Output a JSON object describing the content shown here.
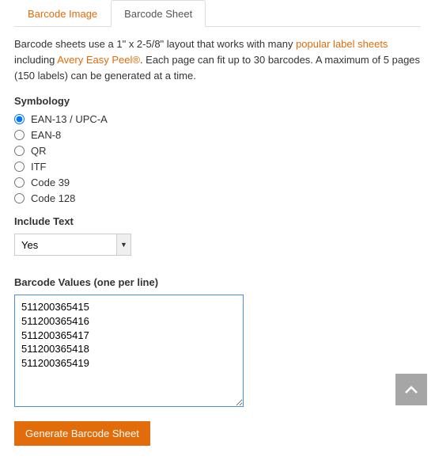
{
  "tabs": [
    {
      "label": "Barcode Image",
      "active": false
    },
    {
      "label": "Barcode Sheet",
      "active": true
    }
  ],
  "intro": {
    "t1": "Barcode sheets use a 1\" x 2-5/8\" layout that works with many ",
    "link1": "popular label sheets",
    "t2": " including ",
    "link2": "Avery Easy Peel®",
    "t3": ". Each page can fit up to 30 barcodes. A maximum of 5 pages (150 labels) can be generated at a time."
  },
  "symbology": {
    "title": "Symbology",
    "options": [
      {
        "label": "EAN-13 / UPC-A",
        "checked": true
      },
      {
        "label": "EAN-8",
        "checked": false
      },
      {
        "label": "QR",
        "checked": false
      },
      {
        "label": "ITF",
        "checked": false
      },
      {
        "label": "Code 39",
        "checked": false
      },
      {
        "label": "Code 128",
        "checked": false
      }
    ]
  },
  "include_text": {
    "title": "Include Text",
    "selected": "Yes"
  },
  "barcode_values": {
    "title": "Barcode Values (one per line)",
    "value": "511200365415\n511200365416\n511200365417\n511200365418\n511200365419"
  },
  "generate_button": "Generate Barcode Sheet",
  "scroll_top_icon": "chevron-up-icon"
}
